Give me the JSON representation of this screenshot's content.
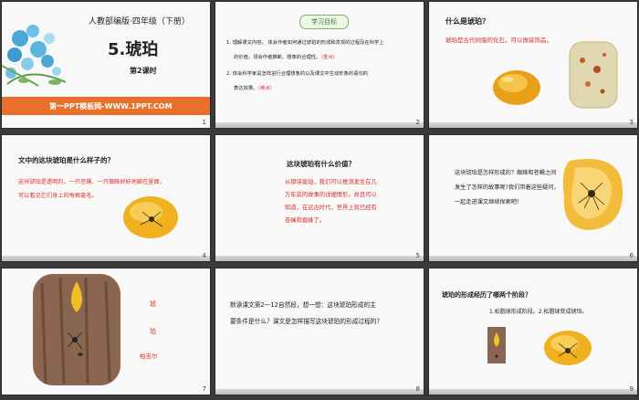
{
  "slide1": {
    "subtitle": "人教部编版·四年级（下册）",
    "title": "5.琥珀",
    "lesson": "第2课时",
    "banner": "第一PPT模板网-WWW.1PPT.COM",
    "num": "1"
  },
  "slide2": {
    "heading": "学习目标",
    "goal1_line1": "1. 理解课文内容。 体会作者如何通过琥珀的形成和发现的过程及在科学上",
    "goal1_line2": "的价值，领会作者推断、想象的合理性。",
    "goal1_tag": "（重点）",
    "goal2_line1": "2. 体会科学家是怎样进行合理想象的以及课文中生动形象的语句的",
    "goal2_line2": "表达效果。",
    "goal2_tag": "（难点）",
    "num": "2"
  },
  "slide3": {
    "question": "什么是琥珀？",
    "answer": "琥珀是古代树脂的化石，可以做装饰品。",
    "num": "3"
  },
  "slide4": {
    "question": "文中的这块琥珀是什么样子的？",
    "line1": "这块琥珀是透明的，一只苍蝇、一只蜘蛛好好地躺在里面，",
    "line2": "可以看见它们身上的每根毫毛。",
    "num": "4"
  },
  "slide5": {
    "question": "这块琥珀有什么价值？",
    "lines": [
      "从那块琥珀，我们可以推测发生在几",
      "万年前的故事的详细情形，并且可以",
      "知道，在远古时代，世界上就已经有",
      "苍蝇和蜘蛛了。"
    ],
    "num": "5"
  },
  "slide6": {
    "lines": [
      "这块琥珀是怎样形成的？蜘蛛和苍蝇之间",
      "发生了怎样的故事呢?我们带着这些疑问，",
      "一起走进课文继续探索吧！"
    ],
    "num": "6"
  },
  "slide7": {
    "c1": "琥",
    "c2": "珀",
    "author": "柏吉尔",
    "num": "7"
  },
  "slide8": {
    "line1": "默读课文第2—12自然段，想一想：这块琥珀形成的主",
    "line2": "要条件是什么？课文是怎样描写这块琥珀的形成过程的？",
    "num": "8"
  },
  "slide9": {
    "question": "琥珀的形成经历了哪两个阶段？",
    "answer": "1.松脂球形成阶段。2.松脂球变成琥珀。",
    "num": "9"
  },
  "colors": {
    "accent_red": "#d8342b",
    "banner_orange": "#e8702a",
    "amber": "#e8a018"
  }
}
